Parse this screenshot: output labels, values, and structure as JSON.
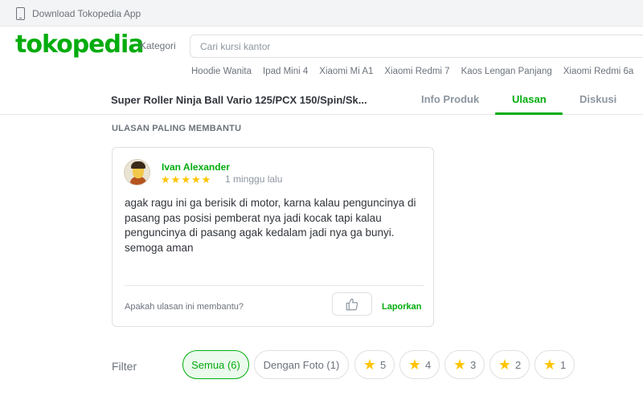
{
  "topbar": {
    "download_text": "Download Tokopedia App"
  },
  "header": {
    "logo": "tokopedia",
    "category_label": "Kategori",
    "search_placeholder": "Cari kursi kantor",
    "quick_links": [
      "Hoodie Wanita",
      "Ipad Mini 4",
      "Xiaomi Mi A1",
      "Xiaomi Redmi 7",
      "Kaos Lengan Panjang",
      "Xiaomi Redmi 6a"
    ]
  },
  "product_bar": {
    "title": "Super Roller Ninja Ball Vario 125/PCX 150/Spin/Sk...",
    "tabs": [
      {
        "label": "Info Produk",
        "active": false
      },
      {
        "label": "Ulasan",
        "active": true
      },
      {
        "label": "Diskusi",
        "active": false
      }
    ]
  },
  "section_title": "ULASAN PALING MEMBANTU",
  "review": {
    "user_name": "Ivan Alexander",
    "rating": 5,
    "date": "1 minggu lalu",
    "text": "agak ragu ini ga berisik di motor, karna kalau penguncinya di pasang pas posisi pemberat nya jadi kocak tapi kalau penguncinya di pasang agak kedalam jadi nya ga bunyi. semoga aman",
    "helpful_question": "Apakah ulasan ini membantu?",
    "report_label": "Laporkan"
  },
  "filter": {
    "label": "Filter",
    "chips": [
      {
        "label": "Semua (6)",
        "active": true
      },
      {
        "label": "Dengan Foto (1)",
        "active": false
      },
      {
        "label": "5",
        "star": true
      },
      {
        "label": "4",
        "star": true
      },
      {
        "label": "3",
        "star": true
      },
      {
        "label": "2",
        "star": true
      },
      {
        "label": "1",
        "star": true
      }
    ]
  },
  "colors": {
    "brand": "#03ac0e",
    "star": "#ffc400"
  }
}
